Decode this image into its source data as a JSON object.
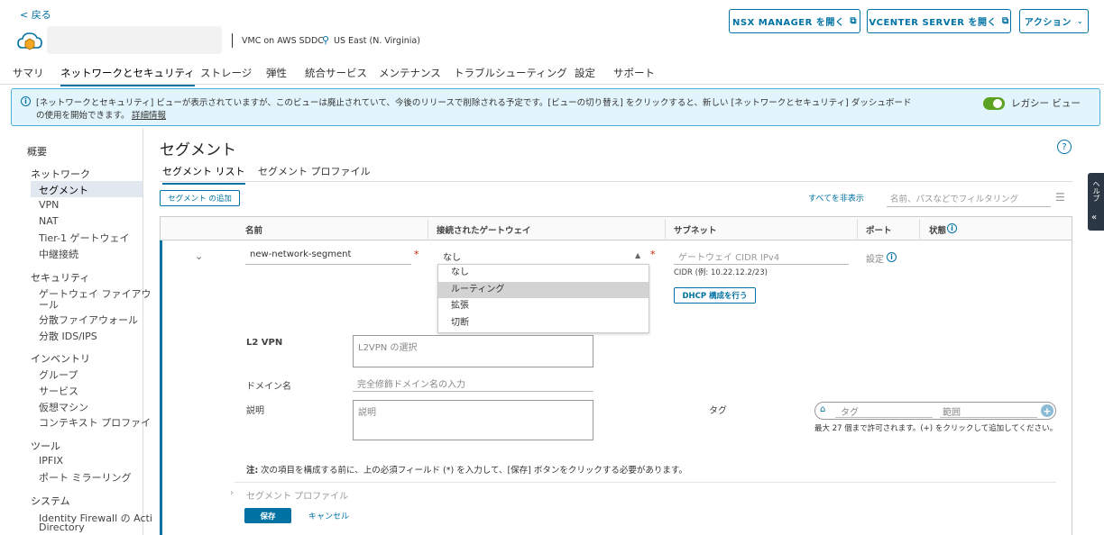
{
  "header": {
    "back_label": "< 戻る",
    "sddc_type": "VMC on AWS SDDC",
    "region": "US East (N. Virginia)",
    "nsx_button": "NSX MANAGER を開く",
    "vcenter_button": "VCENTER SERVER を開く",
    "actions_button": "アクション"
  },
  "tabs": [
    "サマリ",
    "ネットワークとセキュリティ",
    "ストレージ",
    "弾性",
    "統合サービス",
    "メンテナンス",
    "トラブルシューティング",
    "設定",
    "サポート"
  ],
  "banner": {
    "line1": "[ネットワークとセキュリティ] ビューが表示されていますが、このビューは廃止されていて、今後のリリースで削除される予定です。[ビューの切り替え] をクリックすると、新しい [ネットワークとセキュリティ] ダッシュボード",
    "line2": "の使用を開始できます。",
    "link": "詳細情報",
    "toggle_label": "レガシー ビュー"
  },
  "sidebar": {
    "overview": "概要",
    "network": "ネットワーク",
    "network_items": [
      "セグメント",
      "VPN",
      "NAT",
      "Tier-1 ゲートウェイ",
      "中継接続"
    ],
    "security": "セキュリティ",
    "security_items": [
      "ゲートウェイ ファイアウ",
      "ール",
      "分散ファイアウォール",
      "分散 IDS/IPS"
    ],
    "inventory": "インベントリ",
    "inventory_items": [
      "グループ",
      "サービス",
      "仮想マシン",
      "コンテキスト プロファイ"
    ],
    "tools": "ツール",
    "tools_items": [
      "IPFIX",
      "ポート ミラーリング"
    ],
    "system": "システム",
    "system_items": [
      "Identity Firewall の Acti",
      "Directory"
    ]
  },
  "main": {
    "title": "セグメント",
    "subtabs": [
      "セグメント リスト",
      "セグメント プロファイル"
    ],
    "add_button": "セグメント の追加",
    "collapse_all": "すべてを非表示",
    "filter_placeholder": "名前、パスなどでフィルタリング",
    "columns": [
      "名前",
      "接続されたゲートウェイ",
      "サブネット",
      "ポート",
      "状態"
    ]
  },
  "row": {
    "name_value": "new-network-segment",
    "gateway_value": "なし",
    "subnet_placeholder": "ゲートウェイ CIDR IPv4",
    "cidr_hint": "CIDR (例: 10.22.12.2/23)",
    "dhcp_button": "DHCP 構成を行う",
    "port_value": "設定",
    "dropdown_options": [
      "なし",
      "ルーティング",
      "拡張",
      "切断"
    ],
    "l2vpn_label": "L2 VPN",
    "l2vpn_placeholder": "L2VPN の選択",
    "domain_label": "ドメイン名",
    "domain_placeholder": "完全修飾ドメイン名の入力",
    "desc_label": "説明",
    "desc_placeholder": "説明",
    "tag_label": "タグ",
    "tag_placeholder": "タグ",
    "scope_placeholder": "範囲",
    "tag_hint": "最大 27 個まで許可されます。(+) をクリックして追加してください。",
    "note_prefix": "注:",
    "note_text": "次の項目を構成する前に、上の必須フィールド (*) を入力して、[保存] ボタンをクリックする必要があります。",
    "segment_profile": "セグメント プロファイル",
    "save_button": "保存",
    "cancel_button": "キャンセル"
  },
  "side_panel_label": "ヘルプ"
}
